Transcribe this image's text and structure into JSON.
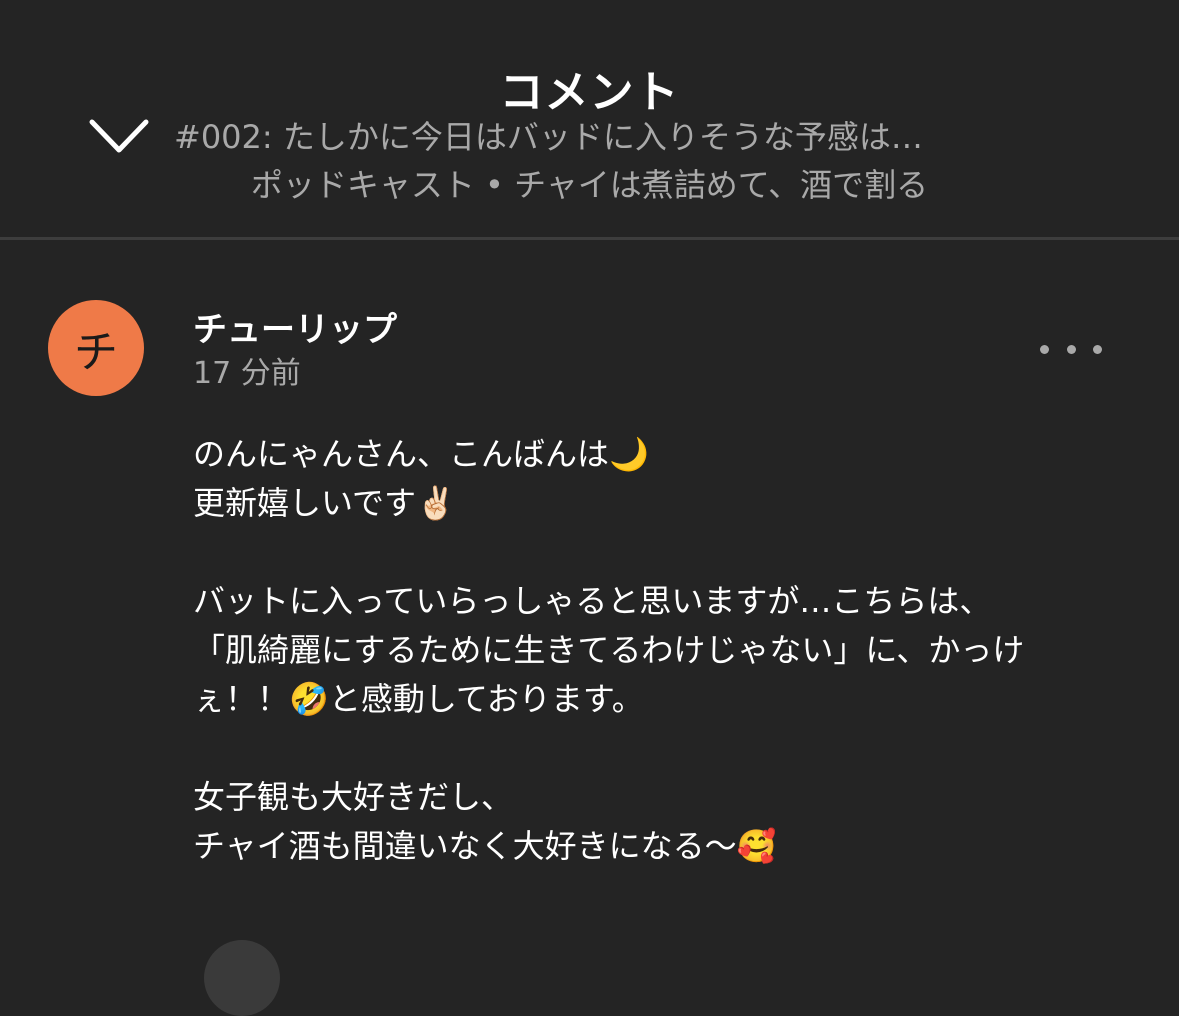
{
  "header": {
    "title": "コメント",
    "episode": "#002: たしかに今日はバッドに入りそうな予感は…",
    "show_line": "ポッドキャスト • チャイは煮詰めて、酒で割る",
    "collapse_icon": "chevron-down-icon"
  },
  "comment": {
    "avatar_initial": "チ",
    "avatar_color": "#ef7a48",
    "username": "チューリップ",
    "timestamp": "17 分前",
    "more_icon": "more-horizontal-icon",
    "body": {
      "line1": "のんにゃんさん、こんばんは🌙",
      "line2": "更新嬉しいです✌🏻",
      "line3": "バットに入っていらっしゃると思いますが…こちらは、",
      "line4": "「肌綺麗にするために生きてるわけじゃない」に、かっけ",
      "line5": "ぇ！！🤣と感動しております。",
      "line6": "女子観も大好きだし、",
      "line7": "チャイ酒も間違いなく大好きになる〜🥰"
    }
  },
  "colors": {
    "background": "#242424",
    "divider": "#3d3d3d",
    "secondary_text": "#a9a9a9"
  }
}
